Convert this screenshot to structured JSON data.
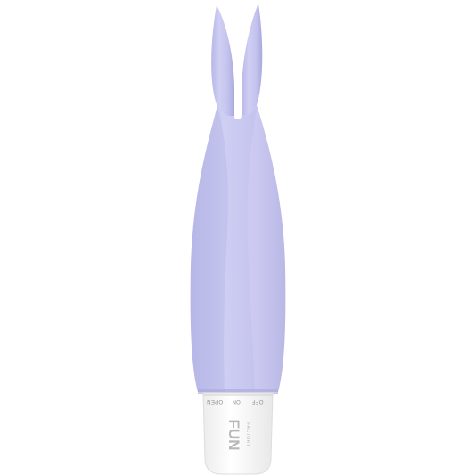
{
  "product": {
    "name": "",
    "body_color": "#c7c6ef",
    "body_shadow": "#aeaddf",
    "body_highlight": "#dcdbf8",
    "cap_color": "#fbfbfb",
    "cap_shadow": "#e6e6e6"
  },
  "switch_labels": {
    "off": "OFF",
    "on": "ON",
    "open": "OPEN"
  },
  "logo": {
    "brand_main": "FUN",
    "brand_sub": "FACTORY"
  }
}
